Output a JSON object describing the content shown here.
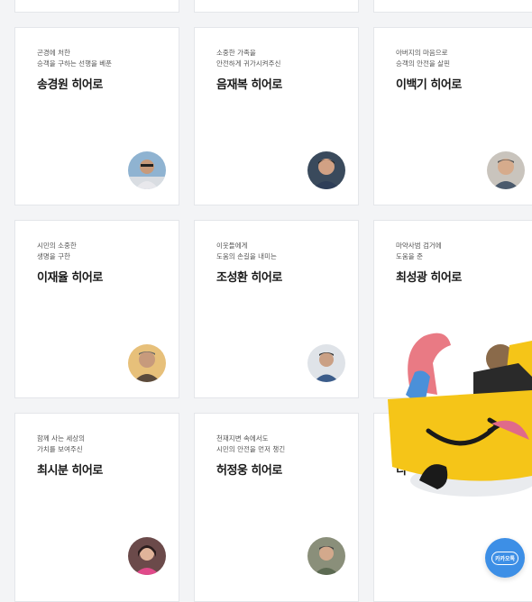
{
  "colors": {
    "page_bg": "#f3f4f6",
    "card_bg": "#ffffff",
    "card_border": "#e4e6ea",
    "accent_yellow": "#f5c518",
    "chat_blue": "#3d8fe6"
  },
  "cards": [
    {
      "desc1": "곤경에 처한",
      "desc2": "승객을 구하는 선행을 베푼",
      "name": "송경원 히어로"
    },
    {
      "desc1": "소중한 가족을",
      "desc2": "안전하게 귀가시켜주신",
      "name": "음재복 히어로"
    },
    {
      "desc1": "아버지의 마음으로",
      "desc2": "승객의 안전을 살핀",
      "name": "이백기 히어로"
    },
    {
      "desc1": "시민의 소중한",
      "desc2": "생명을 구한",
      "name": "이재율 히어로"
    },
    {
      "desc1": "이웃들에게",
      "desc2": "도움의 손길을 내미는",
      "name": "조성환 히어로"
    },
    {
      "desc1": "마약사범 검거에",
      "desc2": "도움을 준",
      "name": "최성광 히어로"
    },
    {
      "desc1": "함께 사는 세상의",
      "desc2": "가치를 보여주신",
      "name": "최시분 히어로"
    },
    {
      "desc1": "천재지변 속에서도",
      "desc2": "시민의 안전을 먼저 챙긴",
      "name": "허정웅 히어로"
    },
    {
      "desc1": "",
      "desc2": "",
      "name": "디"
    }
  ],
  "chat_button": {
    "label": "카카오톡"
  }
}
